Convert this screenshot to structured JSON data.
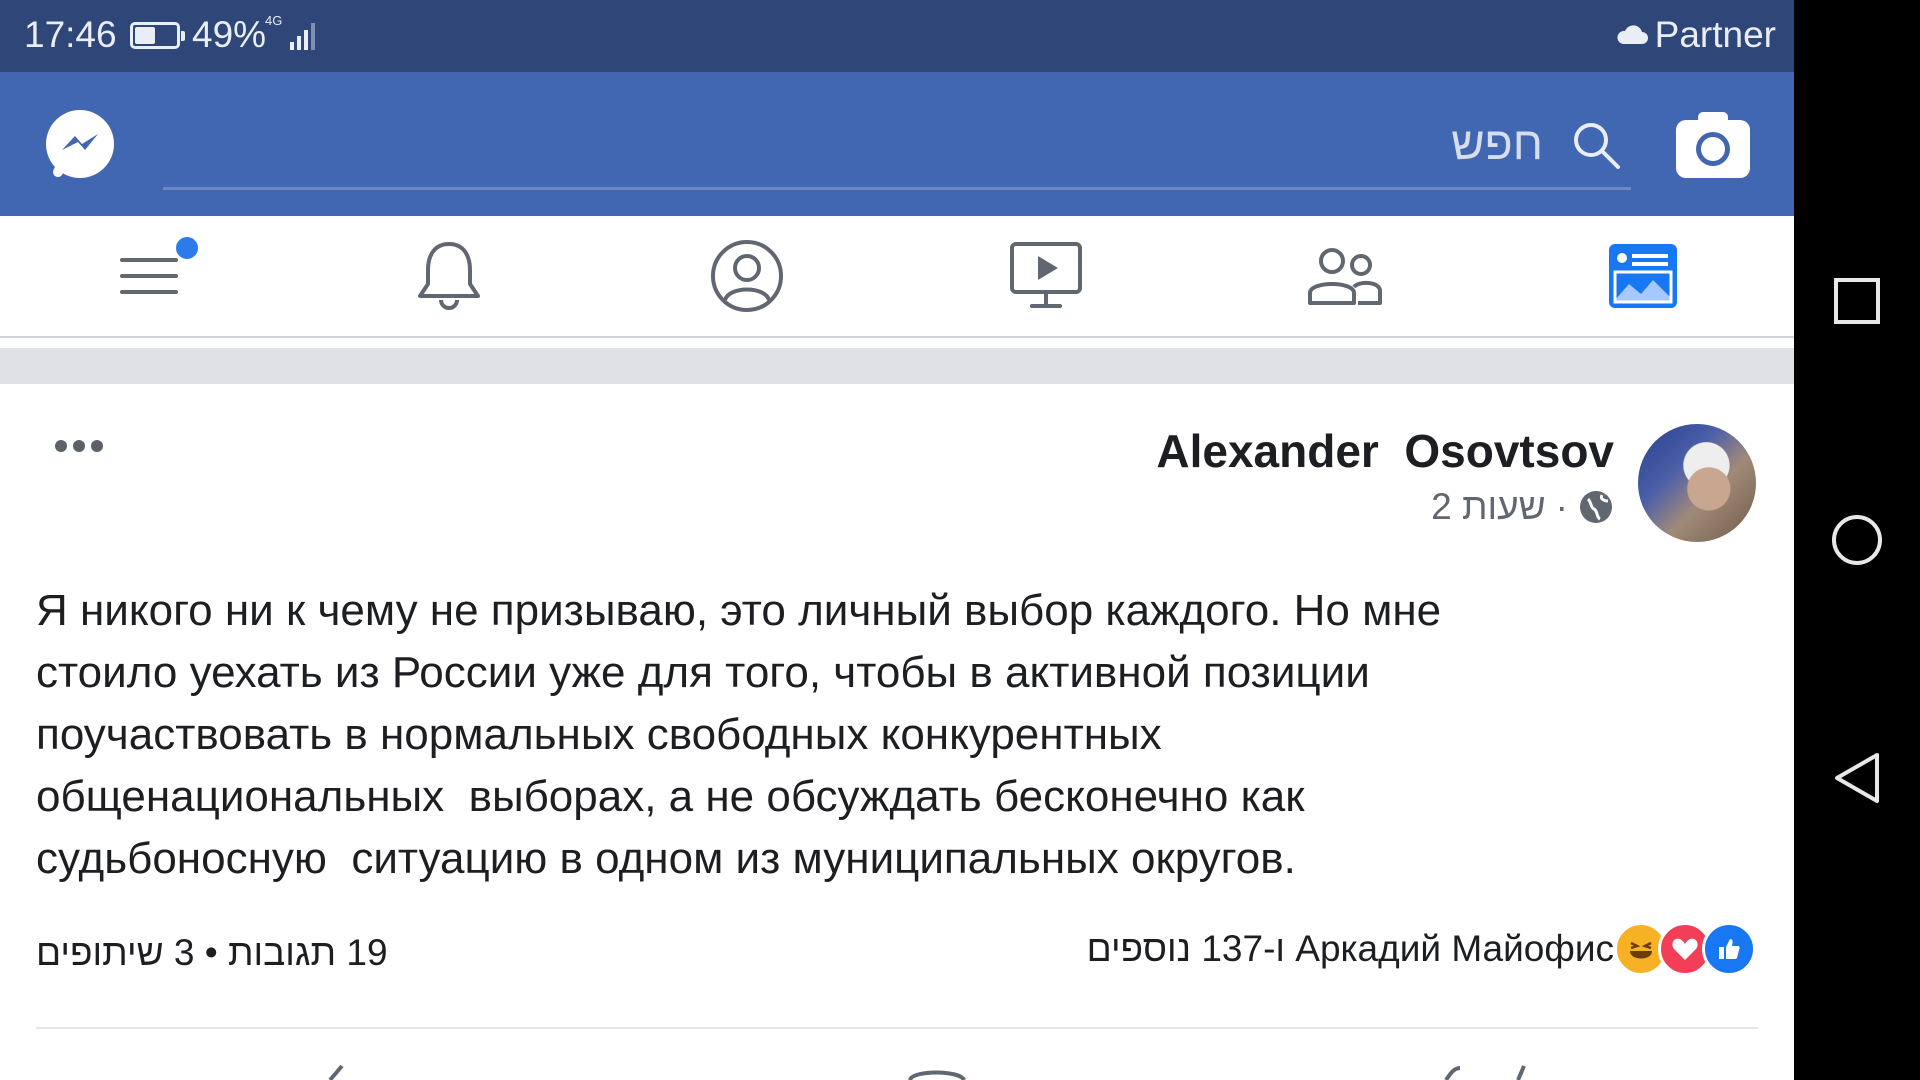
{
  "status_bar": {
    "time": "17:46",
    "battery_percent": "49%",
    "battery_level": 0.49,
    "network": "4G",
    "carrier": "Partner"
  },
  "header": {
    "search_placeholder": "חפש",
    "color": "#4267b2"
  },
  "tabs": [
    {
      "name": "menu",
      "icon": "hamburger-menu-icon",
      "has_badge": true
    },
    {
      "name": "notifications",
      "icon": "bell-icon"
    },
    {
      "name": "profile",
      "icon": "profile-icon"
    },
    {
      "name": "watch",
      "icon": "video-play-icon"
    },
    {
      "name": "friends",
      "icon": "friends-icon"
    },
    {
      "name": "news-feed",
      "icon": "news-feed-icon",
      "active": true
    }
  ],
  "post": {
    "author": "Alexander  Osovtsov",
    "time": "2 שעות",
    "privacy_icon": "globe-icon",
    "text": "Я никого ни к чему не призываю, это личный выбор каждого. Но мне\nстоило уехать из России уже для того, чтобы в активной позиции\nпоучаствовать в нормальных свободных конкурентных\nобщенациональных  выборах, а не обсуждать бесконечно как\nсудьбоносную  ситуацию в одном из муниципальных округов.",
    "comments_shares": "19 תגובות • 3 שיתופים",
    "reactions_text": "Аркадий Майофис ו-137 נוספים",
    "reaction_icons": [
      "like-icon",
      "love-icon",
      "haha-icon"
    ]
  },
  "colors": {
    "status_bar": "#2f4679",
    "accent": "#4267b2",
    "active_tab": "#1877f2",
    "badge": "#2d7bea"
  }
}
